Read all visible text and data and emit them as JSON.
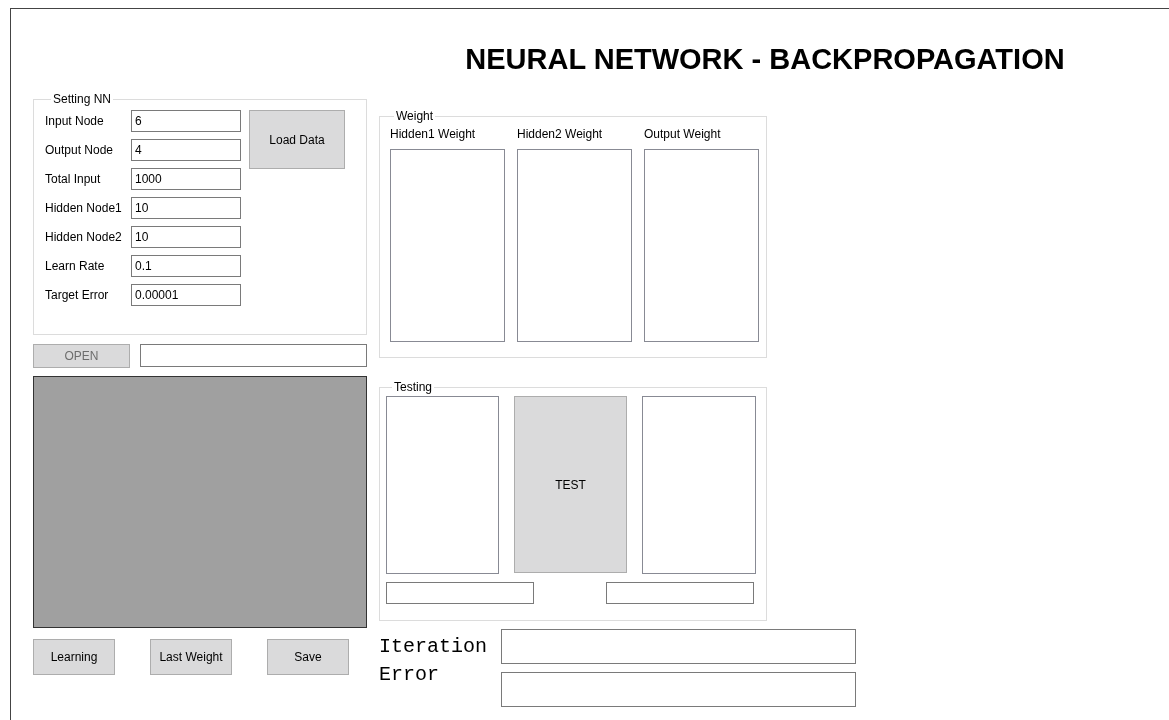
{
  "title": "NEURAL NETWORK - BACKPROPAGATION",
  "settings": {
    "legend": "Setting NN",
    "fields": [
      {
        "label": "Input Node",
        "value": "6"
      },
      {
        "label": "Output Node",
        "value": "4"
      },
      {
        "label": "Total Input",
        "value": "1000"
      },
      {
        "label": "Hidden Node1",
        "value": "10"
      },
      {
        "label": "Hidden Node2",
        "value": "10"
      },
      {
        "label": "Learn Rate",
        "value": "0.1"
      },
      {
        "label": "Target Error",
        "value": "0.00001"
      }
    ],
    "load_button": "Load Data"
  },
  "open_button": {
    "label": "OPEN",
    "disabled": true
  },
  "buttons": [
    "Learning",
    "Last Weight",
    "Save"
  ],
  "weight": {
    "legend": "Weight",
    "columns": [
      "Hidden1 Weight",
      "Hidden2 Weight",
      "Output Weight"
    ]
  },
  "testing": {
    "legend": "Testing",
    "button": "TEST"
  },
  "results": [
    {
      "label": "Iteration"
    },
    {
      "label": "Error"
    }
  ]
}
